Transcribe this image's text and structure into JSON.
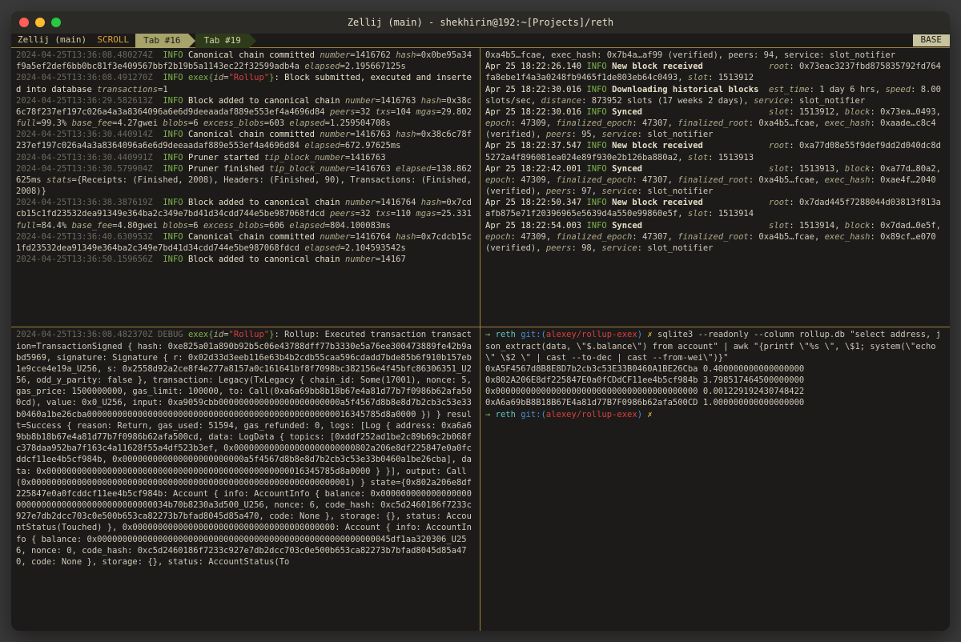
{
  "window": {
    "title": "Zellij (main) - shekhirin@192:~[Projects]/reth"
  },
  "tabbar": {
    "left": "Zellij (main)",
    "scroll": "SCROLL",
    "tab16": "Tab #16",
    "tab19": "Tab #19",
    "base": "BASE"
  },
  "panes": {
    "tl": {
      "lines": [
        {
          "ts": "2024-04-25T13:36:08.480274Z",
          "lvl": "INFO",
          "msg": "Canonical chain committed ",
          "fields": "number=1416762 hash=0x0be95a34f9a5ef2def6bb0bc81f3e409567bbf2b19b5a1143ec22f32599adb4a elapsed=2.195667125s"
        },
        {
          "ts": "2024-04-25T13:36:08.491270Z",
          "lvl": "INFO",
          "exex": true,
          "msg": ": Block submitted, executed and inserted into database ",
          "fields": "transactions=1"
        },
        {
          "ts": "2024-04-25T13:36:29.582613Z",
          "lvl": "INFO",
          "msg": "Block added to canonical chain ",
          "fields": "number=1416763 hash=0x38c6c78f237ef197c026a4a3a8364096a6e6d9deeaadaf889e553ef4a4696d84 peers=32 txs=104 mgas=29.802 full=99.3% base_fee=4.27gwei blobs=6 excess_blobs=603 elapsed=1.259504708s"
        },
        {
          "ts": "2024-04-25T13:36:30.440914Z",
          "lvl": "INFO",
          "msg": "Canonical chain committed ",
          "fields": "number=1416763 hash=0x38c6c78f237ef197c026a4a3a8364096a6e6d9deeaadaf889e553ef4a4696d84 elapsed=672.97625ms"
        },
        {
          "ts": "2024-04-25T13:36:30.440991Z",
          "lvl": "INFO",
          "msg": "Pruner started ",
          "fields": "tip_block_number=1416763"
        },
        {
          "ts": "2024-04-25T13:36:30.579904Z",
          "lvl": "INFO",
          "msg": "Pruner finished ",
          "fields": "tip_block_number=1416763 elapsed=138.862625ms stats={Receipts: (Finished, 2008), Headers: (Finished, 90), Transactions: (Finished, 2008)}"
        },
        {
          "ts": "2024-04-25T13:36:38.387619Z",
          "lvl": "INFO",
          "msg": "Block added to canonical chain ",
          "fields": "number=1416764 hash=0x7cdcb15c1fd23532dea91349e364ba2c349e7bd41d34cdd744e5be987068fdcd peers=32 txs=110 mgas=25.331 full=84.4% base_fee=4.80gwei blobs=6 excess_blobs=606 elapsed=804.100083ms"
        },
        {
          "ts": "2024-04-25T13:36:40.630953Z",
          "lvl": "INFO",
          "msg": "Canonical chain committed ",
          "fields": "number=1416764 hash=0x7cdcb15c1fd23532dea91349e364ba2c349e7bd41d34cdd744e5be987068fdcd elapsed=2.104593542s"
        },
        {
          "ts": "2024-04-25T13:36:50.159656Z",
          "lvl": "INFO",
          "msg": "Block added to canonical chain ",
          "fields": "number=14167"
        }
      ]
    },
    "tr": {
      "pre": "0xa4b5…fcae, exec_hash: 0x7b4a…af99 (verified), peers: 94, service: slot_notifier",
      "lines": [
        {
          "ts": "Apr 25 18:22:26.140",
          "lvl": "INFO",
          "msg": "New block received",
          "right": "root: 0x73eac3237fbd875835792fd764fa8ebe1f4a3a0248fb9465f1de803eb64c0493, slot: 1513912"
        },
        {
          "ts": "Apr 25 18:22:30.016",
          "lvl": "INFO",
          "msg": "Downloading historical blocks",
          "right": "est_time: 1 day 6 hrs, speed: 8.00 slots/sec, distance: 873952 slots (17 weeks 2 days), service: slot_notifier"
        },
        {
          "ts": "Apr 25 18:22:30.016",
          "lvl": "INFO",
          "msg": "Synced",
          "right": "slot: 1513912, block: 0x73ea…0493, epoch: 47309, finalized_epoch: 47307, finalized_root: 0xa4b5…fcae, exec_hash: 0xaade…c8c4 (verified), peers: 95, service: slot_notifier"
        },
        {
          "ts": "Apr 25 18:22:37.547",
          "lvl": "INFO",
          "msg": "New block received",
          "right": "root: 0xa77d08e55f9def9dd2d040dc8d5272a4f896081ea024e89f930e2b126ba880a2, slot: 1513913"
        },
        {
          "ts": "Apr 25 18:22:42.001",
          "lvl": "INFO",
          "msg": "Synced",
          "right": "slot: 1513913, block: 0xa77d…80a2, epoch: 47309, finalized_epoch: 47307, finalized_root: 0xa4b5…fcae, exec_hash: 0xae4f…2040 (verified), peers: 97, service: slot_notifier"
        },
        {
          "ts": "Apr 25 18:22:50.347",
          "lvl": "INFO",
          "msg": "New block received",
          "right": "root: 0x7dad445f7288044d03813f813aafb875e71f20396965e5639d4a550e99860e5f, slot: 1513914"
        },
        {
          "ts": "Apr 25 18:22:54.003",
          "lvl": "INFO",
          "msg": "Synced",
          "right": "slot: 1513914, block: 0x7dad…0e5f, epoch: 47309, finalized_epoch: 47307, finalized_root: 0xa4b5…fcae, exec_hash: 0x89cf…e070 (verified), peers: 98, service: slot_notifier"
        }
      ]
    },
    "bl": {
      "ts": "2024-04-25T13:36:08.482370Z",
      "lvl": "DEBUG",
      "exex": true,
      "body": ": Rollup: Executed transaction transaction=TransactionSigned { hash: 0xe825a01a890b92b5c06e43788dff77b3330e5a76ee300473889fe42b9abd5969, signature: Signature { r: 0x02d33d3eeb116e63b4b2cdb55caa596cdadd7bde85b6f910b157eb1e9cce4e19a_U256, s: 0x2558d92a2ce8f4e277a8157a0c161641bf8f7098bc382156e4f45bfc86306351_U256, odd_y_parity: false }, transaction: Legacy(TxLegacy { chain_id: Some(17001), nonce: 5, gas_price: 1500000000, gas_limit: 100000, to: Call(0xa6a69bb8b18b67e4a81d77b7f0986b62afa500cd), value: 0x0_U256, input: 0xa9059cbb000000000000000000000000a5f4567d8b8e8d7b2cb3c53e33b0460a1be26cba0000000000000000000000000000000000000000000000000016345785d8a0000 }) } result=Success { reason: Return, gas_used: 51594, gas_refunded: 0, logs: [Log { address: 0xa6a69bb8b18b67e4a81d77b7f0986b62afa500cd, data: LogData { topics: [0xddf252ad1be2c89b69c2b068fc378daa952ba7f163c4a11628f55a4df523b3ef, 0x000000000000000000000000802a206e8df225847e0a0fcddcf11ee4b5cf984b, 0x000000000000000000000000a5f4567d8b8e8d7b2cb3c53e33b0460a1be26cba], data: 0x000000000000000000000000000000000000000000000000016345785d8a0000 } }], output: Call(0x000000000000000000000000000000000000000000000000000000000000001) } state={0x802a206e8df225847e0a0fcddcf11ee4b5cf984b: Account { info: AccountInfo { balance: 0x000000000000000000000000000000000000000000000034b70b8230a3d500_U256, nonce: 6, code_hash: 0xc5d2460186f7233c927e7db2dcc703c0e500b653ca82273b7bfad8045d85a470, code: None }, storage: {}, status: AccountStatus(Touched) }, 0x0000000000000000000000000000000000000000: Account { info: AccountInfo { balance: 0x0000000000000000000000000000000000000000000000000000000045df1aa320306_U256, nonce: 0, code_hash: 0xc5d2460186f7233c927e7db2dcc703c0e500b653ca82273b7bfad8045d85a470, code: None }, storage: {}, status: AccountStatus(To"
    },
    "br": {
      "prompt": {
        "arrow": "→",
        "reth": "reth",
        "git": "git:(",
        "branch": "alexey/rollup-exex",
        "gitclose": ")",
        "x": "✗"
      },
      "cmd": "sqlite3 --readonly --column rollup.db \"select address, json_extract(data, \\\"$.balance\\\") from account\" | awk \"{printf \\\"%s \\\", \\$1; system(\\\"echo \\\" \\$2 \\\" | cast --to-dec | cast --from-wei\\\")}\"",
      "rows": [
        "0xA5F4567d8B8E8D7b2cb3c53E33B0460A1BE26Cba 0.400000000000000000",
        "0x802A206E8df225847E0a0fCDdCF11ee4b5cf984b 3.798517464500000000",
        "0x0000000000000000000000000000000000000000 0.001229192430748422",
        "0xA6a69bB8B18B67E4a81d77B7F0986b62afa500CD 1.000000000000000000"
      ]
    }
  }
}
